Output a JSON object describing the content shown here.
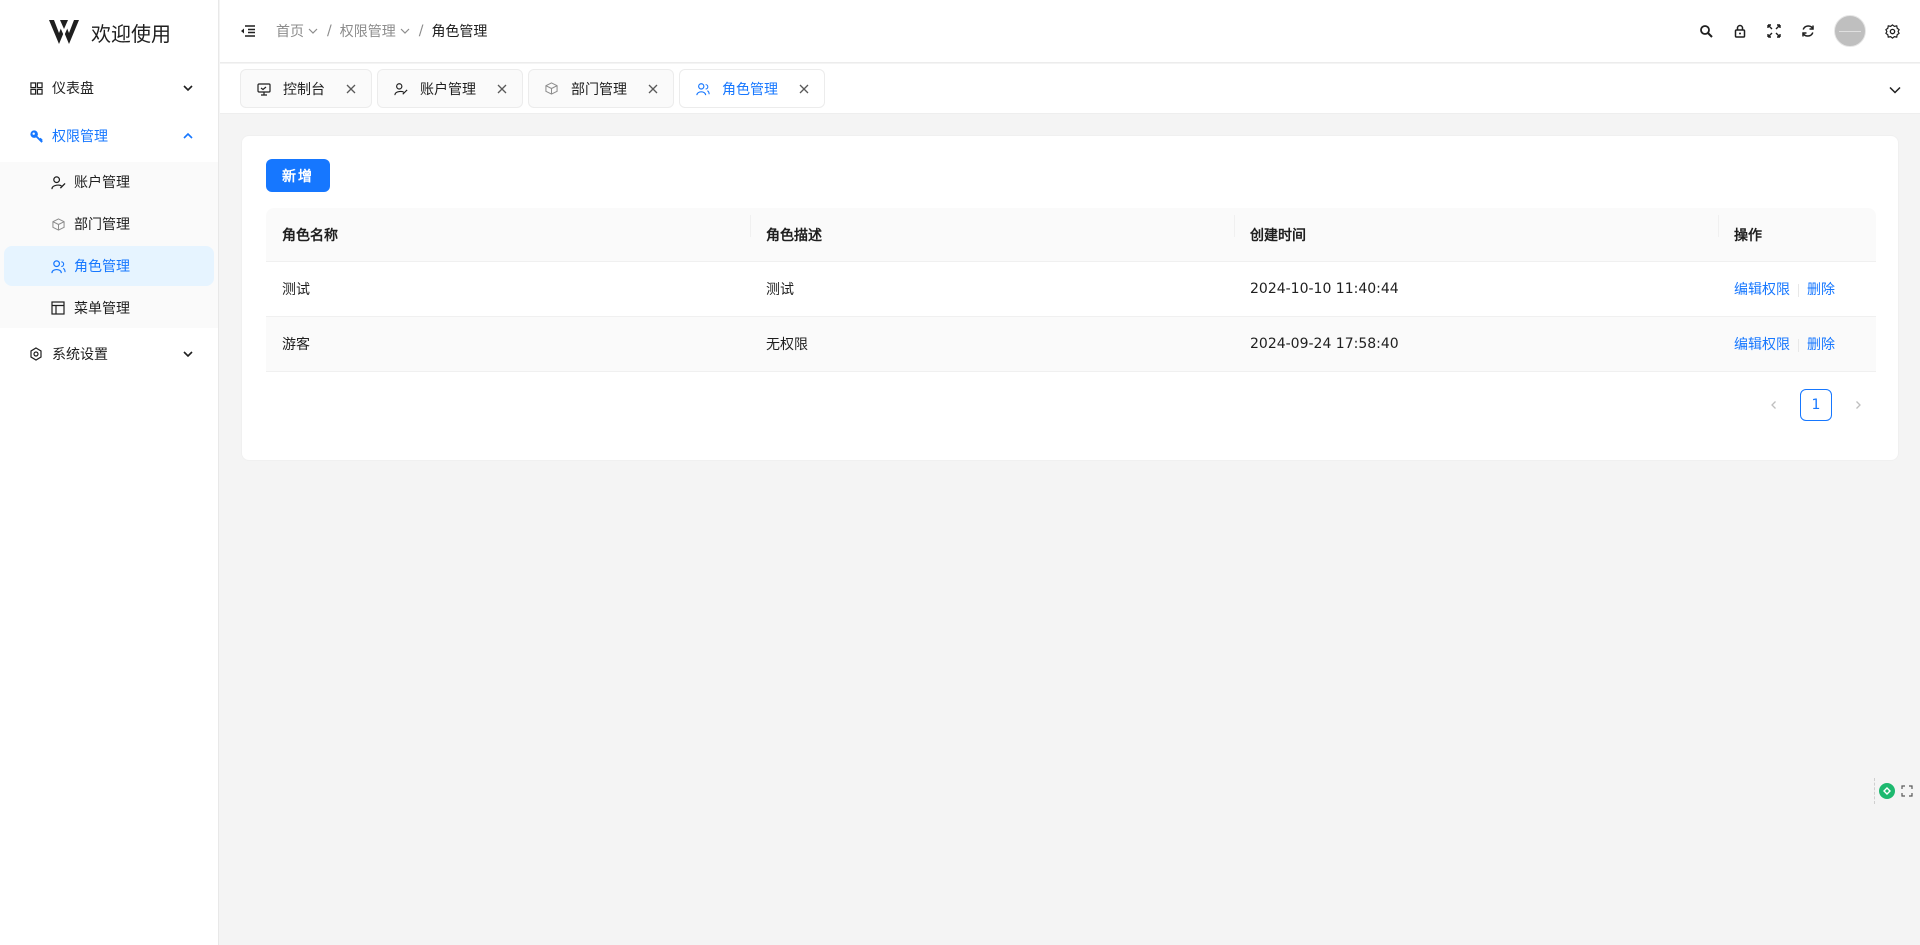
{
  "sidebar": {
    "logo_text": "欢迎使用",
    "items": [
      {
        "label": "仪表盘",
        "icon": "dashboard-icon"
      },
      {
        "label": "权限管理",
        "icon": "key-icon",
        "open": true,
        "children": [
          {
            "label": "账户管理",
            "icon": "user-edit-icon"
          },
          {
            "label": "部门管理",
            "icon": "cube-icon"
          },
          {
            "label": "角色管理",
            "icon": "user-group-icon",
            "active": true
          },
          {
            "label": "菜单管理",
            "icon": "layout-icon"
          }
        ]
      },
      {
        "label": "系统设置",
        "icon": "settings-icon"
      }
    ]
  },
  "header": {
    "breadcrumb": [
      "首页",
      "权限管理",
      "角色管理"
    ],
    "separator": "/"
  },
  "tabs": [
    {
      "label": "控制台",
      "icon": "monitor-icon"
    },
    {
      "label": "账户管理",
      "icon": "user-edit-icon"
    },
    {
      "label": "部门管理",
      "icon": "cube-icon"
    },
    {
      "label": "角色管理",
      "icon": "user-group-icon",
      "active": true
    }
  ],
  "toolbar": {
    "add_label": "新增"
  },
  "table": {
    "columns": [
      "角色名称",
      "角色描述",
      "创建时间",
      "操作"
    ],
    "rows": [
      {
        "name": "测试",
        "desc": "测试",
        "created": "2024-10-10 11:40:44"
      },
      {
        "name": "游客",
        "desc": "无权限",
        "created": "2024-09-24 17:58:40"
      }
    ],
    "actions": {
      "edit": "编辑权限",
      "delete": "删除"
    }
  },
  "pagination": {
    "current": "1"
  },
  "colors": {
    "primary": "#1677ff",
    "active_bg": "#e6f4ff"
  }
}
